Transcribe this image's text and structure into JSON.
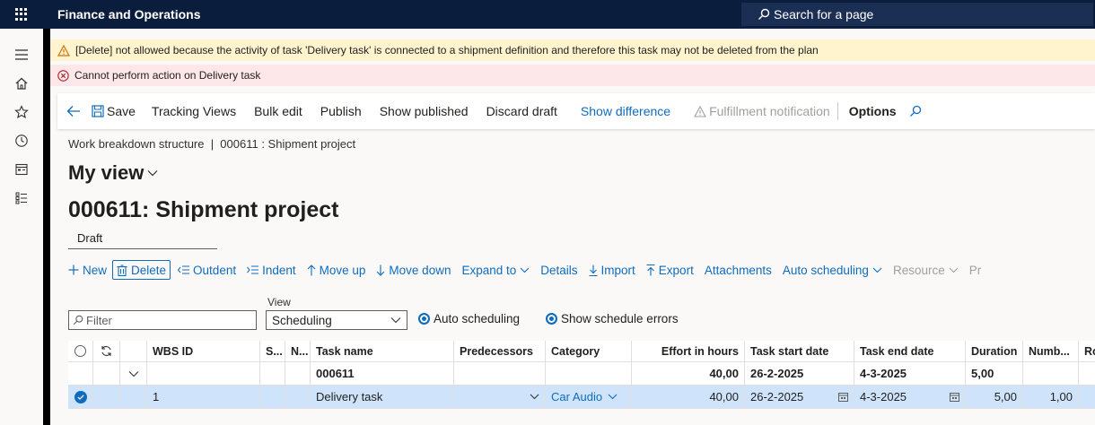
{
  "topbar": {
    "app_title": "Finance and Operations",
    "search_label": "Search for a page"
  },
  "messages": {
    "warning": "[Delete] not allowed because the activity of task 'Delivery task' is connected to a shipment definition and therefore this task may not be deleted from the plan",
    "error": "Cannot perform action on Delivery task"
  },
  "toolbar": {
    "save": "Save",
    "tracking_views": "Tracking Views",
    "bulk_edit": "Bulk edit",
    "publish": "Publish",
    "show_published": "Show published",
    "discard_draft": "Discard draft",
    "show_difference": "Show difference",
    "fulfillment_notification": "Fulfillment notification",
    "options": "Options"
  },
  "page": {
    "breadcrumb": "Work breakdown structure  |  000611 : Shipment project",
    "view_name": "My view",
    "title": "000611: Shipment project",
    "status": "Draft"
  },
  "actions": {
    "new": "New",
    "delete": "Delete",
    "outdent": "Outdent",
    "indent": "Indent",
    "move_up": "Move up",
    "move_down": "Move down",
    "expand_to": "Expand to",
    "details": "Details",
    "import": "Import",
    "export": "Export",
    "attachments": "Attachments",
    "auto_scheduling": "Auto scheduling",
    "resource": "Resource",
    "more": "Pr"
  },
  "filters": {
    "filter_placeholder": "Filter",
    "view_label": "View",
    "view_value": "Scheduling",
    "auto_scheduling": "Auto scheduling",
    "show_schedule_errors": "Show schedule errors"
  },
  "grid": {
    "columns": {
      "wbs_id": "WBS ID",
      "s": "S...",
      "n": "N...",
      "task_name": "Task name",
      "predecessors": "Predecessors",
      "category": "Category",
      "effort": "Effort in hours",
      "start": "Task start date",
      "end": "Task end date",
      "duration": "Duration",
      "number": "Numb...",
      "r": "Ro"
    },
    "rows": [
      {
        "wbs_id": "",
        "task_name": "000611",
        "predecessors": "",
        "category": "",
        "effort": "40,00",
        "start": "26-2-2025",
        "end": "4-3-2025",
        "duration": "5,00",
        "number": ""
      },
      {
        "wbs_id": "1",
        "task_name": "Delivery task",
        "predecessors": "",
        "category": "Car Audio",
        "effort": "40,00",
        "start": "26-2-2025",
        "end": "4-3-2025",
        "duration": "5,00",
        "number": "1,00"
      }
    ]
  },
  "colors": {
    "topbar": "#0b1d3d",
    "accent": "#0f6cbd",
    "warning_bg": "#fff4ce",
    "error_bg": "#fde7e9",
    "selected_row": "#cfe4fa"
  }
}
